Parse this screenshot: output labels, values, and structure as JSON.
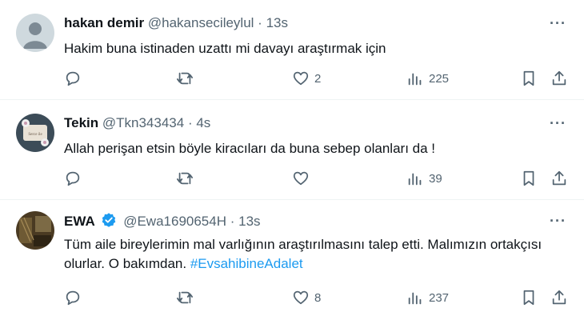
{
  "tweets": [
    {
      "name": "hakan demir",
      "handle": "@hakansecileylul",
      "dot": "·",
      "time": "13s",
      "text": "Hakim buna istinaden uzattı mi davayı araştırmak için",
      "likes": "2",
      "views": "225"
    },
    {
      "name": "Tekin",
      "handle": "@Tkn343434",
      "dot": "·",
      "time": "4s",
      "text": "Allah perişan etsin böyle kiracıları da buna sebep olanları da !",
      "avatar_text": "Serce ile",
      "likes": "",
      "views": "39"
    },
    {
      "name": "EWA",
      "handle": "@Ewa1690654H",
      "dot": "·",
      "time": "13s",
      "text": "Tüm aile bireylerimin mal varlığının araştırılmasını talep etti. Malımızın ortakçısı olurlar. O bakımdan.",
      "hashtag": "#EvsahibineAdalet",
      "likes": "8",
      "views": "237"
    }
  ],
  "colors": {
    "accent": "#1d9bf0",
    "muted": "#536471",
    "text": "#0f1419"
  },
  "icons": [
    "reply-icon",
    "retweet-icon",
    "like-icon",
    "views-icon",
    "bookmark-icon",
    "share-icon",
    "more-icon",
    "verified-icon"
  ]
}
